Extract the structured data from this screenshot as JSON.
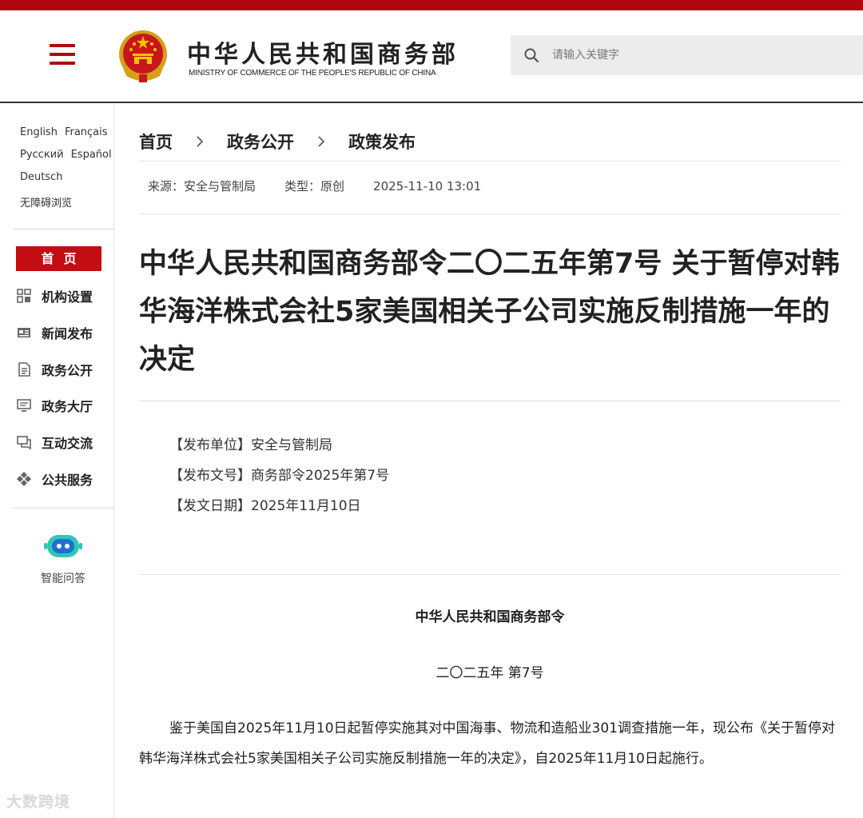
{
  "header": {
    "title": "中华人民共和国商务部",
    "subtitle": "MINISTRY OF COMMERCE OF THE PEOPLE'S REPUBLIC OF CHINA",
    "search_placeholder": "请输入关键字"
  },
  "sidebar": {
    "languages_row1": [
      "English",
      "Français"
    ],
    "languages_row2": [
      "Русский",
      "Español"
    ],
    "languages_row3": [
      "Deutsch"
    ],
    "accessibility": "无障碍浏览",
    "home": "首页",
    "nav": [
      {
        "label": "机构设置",
        "icon": "grid-icon"
      },
      {
        "label": "新闻发布",
        "icon": "newspaper-icon"
      },
      {
        "label": "政务公开",
        "icon": "document-icon"
      },
      {
        "label": "政务大厅",
        "icon": "monitor-icon"
      },
      {
        "label": "互动交流",
        "icon": "chat-icon"
      },
      {
        "label": "公共服务",
        "icon": "service-icon"
      }
    ],
    "ai_label": "智能问答"
  },
  "breadcrumb": [
    "首页",
    "政务公开",
    "政策发布"
  ],
  "meta": {
    "source": "来源：安全与管制局",
    "type": "类型：原创",
    "datetime": "2025-11-10 13:01"
  },
  "article": {
    "title": "中华人民共和国商务部令二〇二五年第7号 关于暂停对韩华海洋株式会社5家美国相关子公司实施反制措施一年的决定",
    "info": [
      "【发布单位】安全与管制局",
      "【发布文号】商务部令2025年第7号",
      "【发文日期】2025年11月10日"
    ],
    "doc_org": "中华人民共和国商务部令",
    "doc_num": "二〇二五年 第7号",
    "body": "鉴于美国自2025年11月10日起暂停实施其对中国海事、物流和造船业301调查措施一年，现公布《关于暂停对韩华海洋株式会社5家美国相关子公司实施反制措施一年的决定》，自2025年11月10日起施行。"
  },
  "watermark": "大数跨境",
  "colors": {
    "brand_red": "#b1060d",
    "home_red": "#c20d13"
  }
}
